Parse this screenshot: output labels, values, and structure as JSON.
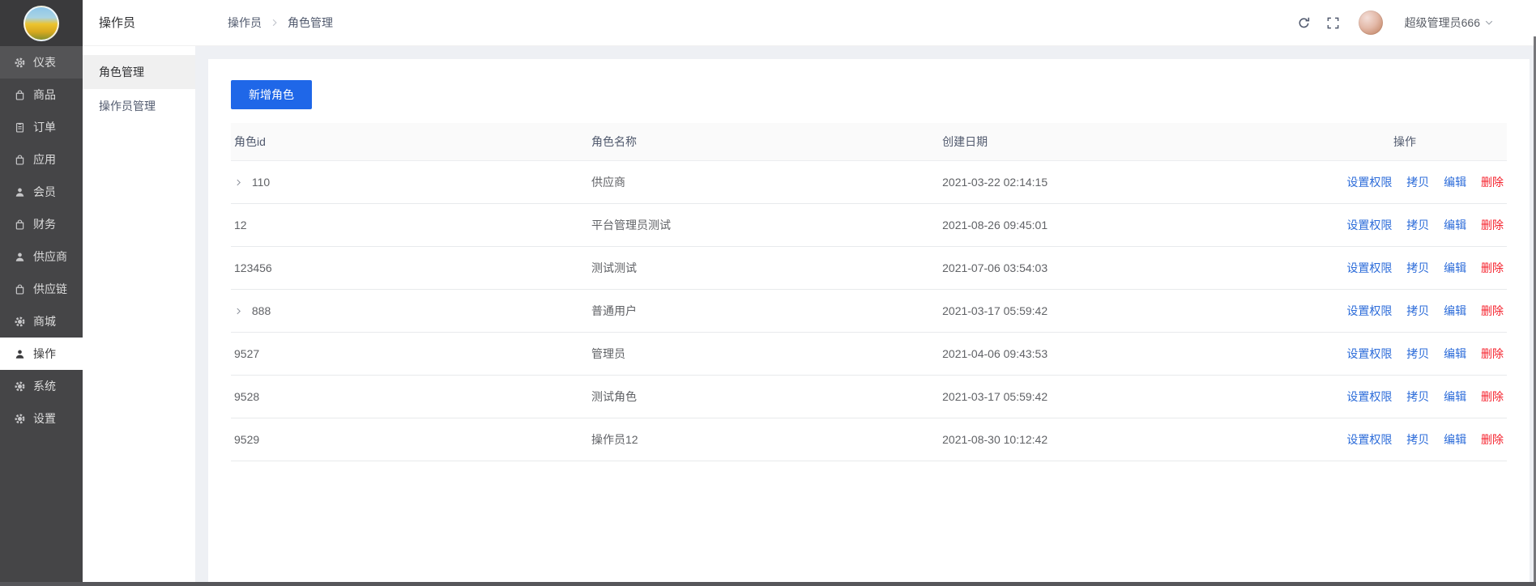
{
  "sidebar": {
    "items": [
      {
        "label": "仪表",
        "icon": "gauge-gear-icon"
      },
      {
        "label": "商品",
        "icon": "bag-icon"
      },
      {
        "label": "订单",
        "icon": "clipboard-icon"
      },
      {
        "label": "应用",
        "icon": "bag-icon"
      },
      {
        "label": "会员",
        "icon": "person-icon"
      },
      {
        "label": "财务",
        "icon": "bag-icon"
      },
      {
        "label": "供应商",
        "icon": "person-icon"
      },
      {
        "label": "供应链",
        "icon": "bag-icon"
      },
      {
        "label": "商城",
        "icon": "gear-icon"
      },
      {
        "label": "操作",
        "icon": "person-icon"
      },
      {
        "label": "系统",
        "icon": "gear-icon"
      },
      {
        "label": "设置",
        "icon": "gear-icon"
      }
    ]
  },
  "submenu": {
    "title": "操作员",
    "items": [
      {
        "label": "角色管理",
        "active": true
      },
      {
        "label": "操作员管理",
        "active": false
      }
    ]
  },
  "header": {
    "breadcrumb": [
      "操作员",
      "角色管理"
    ],
    "user": "超级管理员666"
  },
  "content": {
    "add_button": "新增角色",
    "table": {
      "columns": [
        "角色id",
        "角色名称",
        "创建日期",
        "操作"
      ],
      "actions": [
        "设置权限",
        "拷贝",
        "编辑",
        "删除"
      ],
      "rows": [
        {
          "id": "110",
          "expandable": true,
          "name": "供应商",
          "created": "2021-03-22 02:14:15"
        },
        {
          "id": "12",
          "expandable": false,
          "name": "平台管理员测试",
          "created": "2021-08-26 09:45:01"
        },
        {
          "id": "123456",
          "expandable": false,
          "name": "测试测试",
          "created": "2021-07-06 03:54:03"
        },
        {
          "id": "888",
          "expandable": true,
          "name": "普通用户",
          "created": "2021-03-17 05:59:42"
        },
        {
          "id": "9527",
          "expandable": false,
          "name": "管理员",
          "created": "2021-04-06 09:43:53"
        },
        {
          "id": "9528",
          "expandable": false,
          "name": "测试角色",
          "created": "2021-03-17 05:59:42"
        },
        {
          "id": "9529",
          "expandable": false,
          "name": "操作员12",
          "created": "2021-08-30 10:12:42"
        }
      ]
    }
  },
  "colors": {
    "accent_blue": "#1f67e8",
    "link_blue": "#2b6bd9",
    "danger_red": "#f5222d",
    "sidebar_bg": "#454547",
    "page_bg": "#eef0f4"
  }
}
